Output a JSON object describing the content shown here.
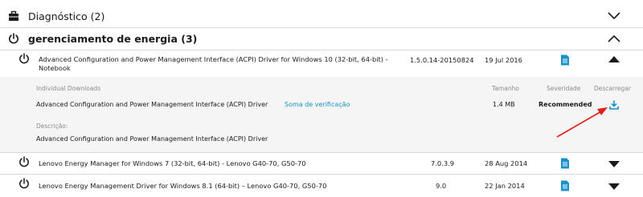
{
  "categories": [
    {
      "label": "Diagnóstico (2)",
      "icon": "briefcase-icon",
      "state": "collapsed"
    },
    {
      "label": "gerenciamento de energia (3)",
      "icon": "power-icon",
      "state": "expanded"
    }
  ],
  "drivers": [
    {
      "name": "Advanced Configuration and Power Management Interface (ACPI) Driver for Windows 10 (32-bit, 64-bit) - Notebook",
      "version": "1.5.0.14-20150824",
      "date": "19 Jul 2016",
      "expanded": true
    },
    {
      "name": "Lenovo Energy Manager for Windows 7 (32-bit, 64-bit) - Lenovo G40-70, G50-70",
      "version": "7.0.3.9",
      "date": "28 Aug 2014",
      "expanded": false
    },
    {
      "name": "Lenovo Energy Management Driver for Windows 8.1 (64-bit) – Lenovo G40-70, G50-70",
      "version": "9.0",
      "date": "22 Jan 2014",
      "expanded": false
    }
  ],
  "details": {
    "headers": {
      "individual_downloads": "Individual Downloads",
      "size": "Tamanho",
      "severity": "Severidade",
      "download": "Descarregar"
    },
    "file": {
      "name": "Advanced Configuration and Power Management Interface (ACPI) Driver",
      "checksum_link": "Soma de verificação",
      "size": "1.4 MB",
      "severity": "Recommended"
    },
    "description_label": "Descrição:",
    "description": "Advanced Configuration and Power Management Interface (ACPI) Driver"
  },
  "colors": {
    "accent": "#1a8fc9",
    "annotation_arrow": "#e0201b",
    "detail_bg": "#f5f5f5"
  }
}
